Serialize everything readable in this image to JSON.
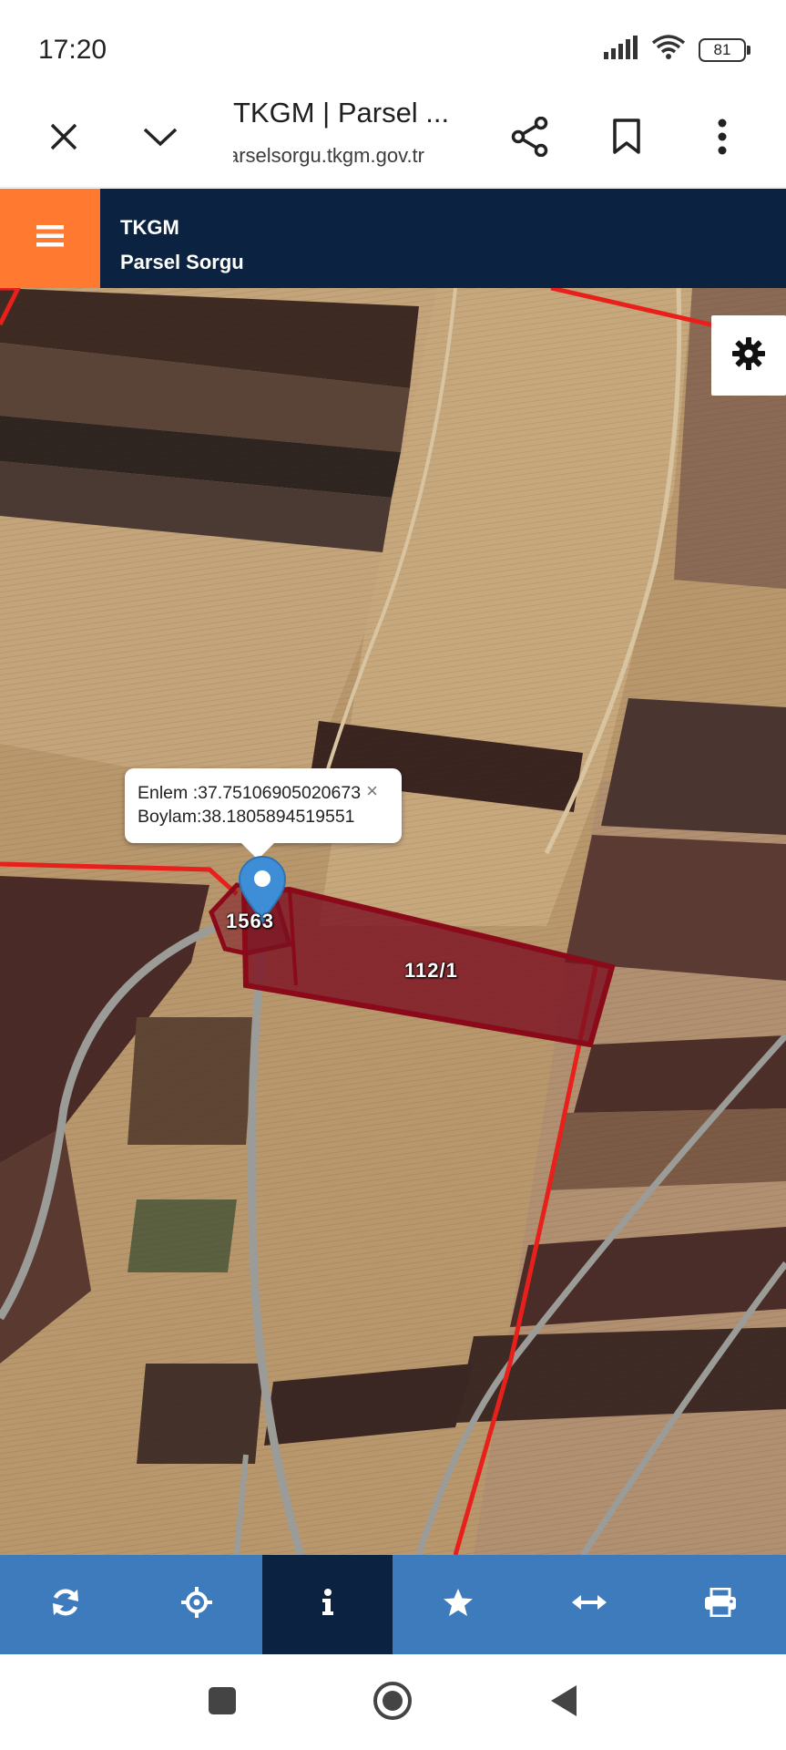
{
  "status_bar": {
    "time": "17:20",
    "battery": "81"
  },
  "browser": {
    "tab_title": "TKGM | Parsel ...",
    "url": "parselsorgu.tkgm.gov.tr",
    "icons": [
      "close-icon",
      "chevron-down-icon",
      "share-icon",
      "bookmark-icon",
      "more-vert-icon"
    ]
  },
  "app": {
    "title": "TKGM",
    "subtitle": "Parsel Sorgu",
    "accent_color": "#ff7a30",
    "header_color": "#0b2340"
  },
  "map": {
    "popup": {
      "lat_line": "Enlem  :37.75106905020673",
      "lon_line": "Boylam:38.1805894519551",
      "close": "×"
    },
    "parcels": {
      "selected": "112/1",
      "neighbor": "1563"
    },
    "boundary_color": "#e8201c",
    "selected_fill": "#7a1020"
  },
  "toolbar": {
    "color": "#3d7bbd",
    "active_color": "#0b2340",
    "items": [
      {
        "icon": "refresh-icon",
        "active": false
      },
      {
        "icon": "crosshair-icon",
        "active": false
      },
      {
        "icon": "info-icon",
        "active": true
      },
      {
        "icon": "star-icon",
        "active": false
      },
      {
        "icon": "measure-icon",
        "active": false
      },
      {
        "icon": "print-icon",
        "active": false
      }
    ]
  }
}
